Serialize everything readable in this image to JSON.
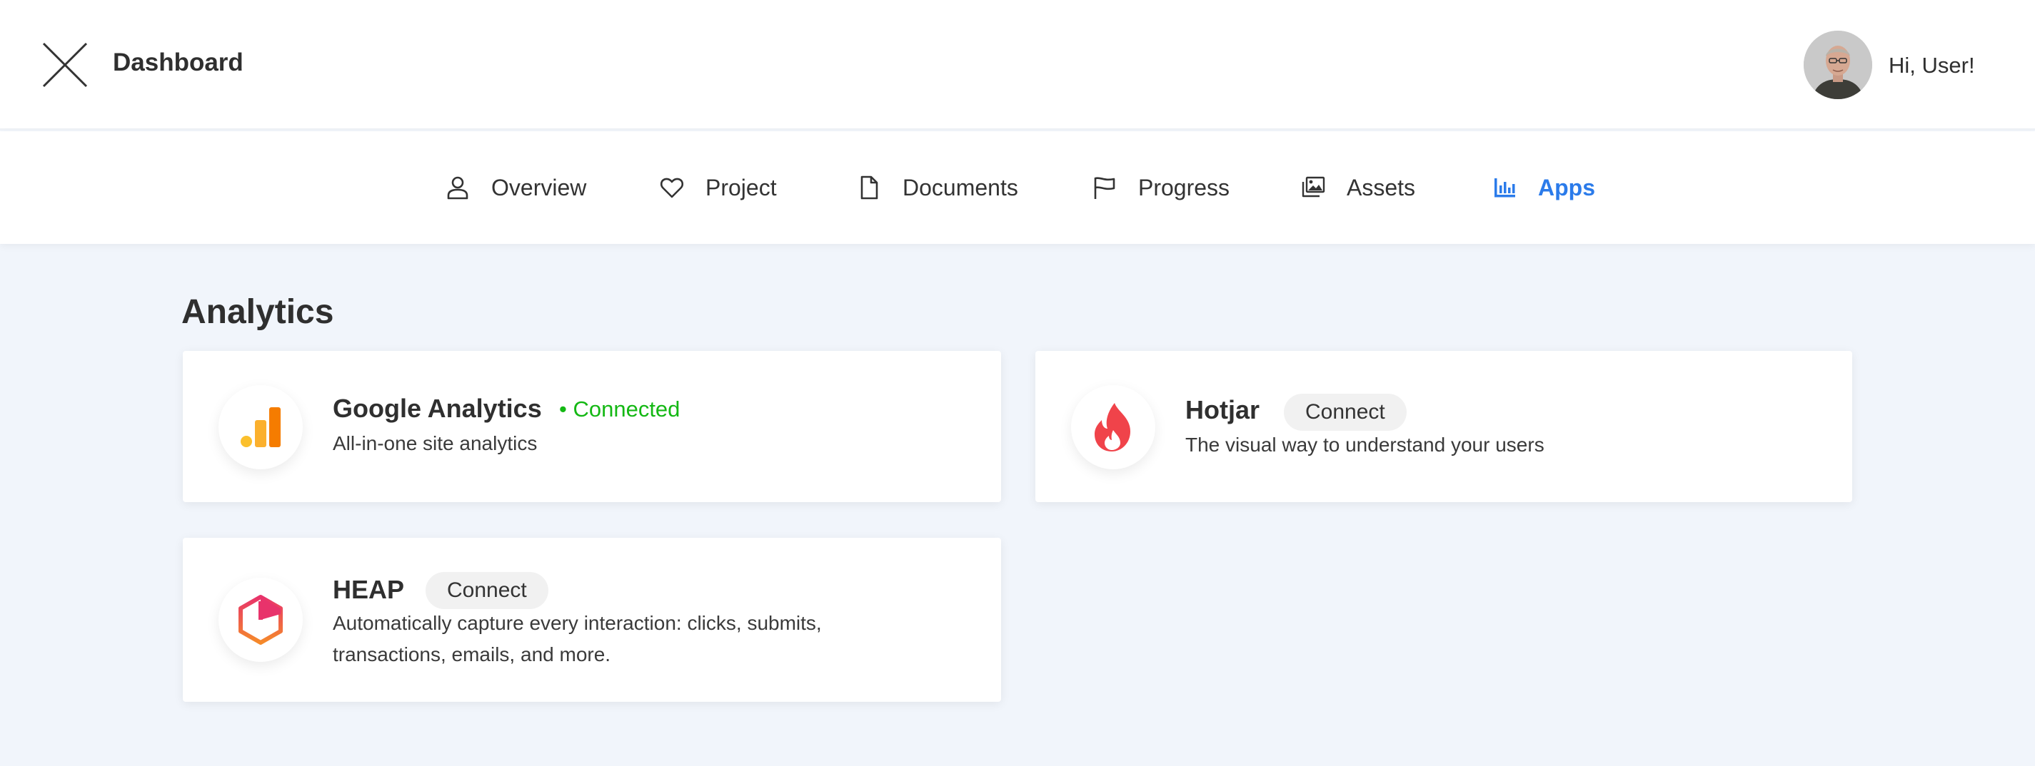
{
  "header": {
    "title": "Dashboard",
    "greeting": "Hi, User!"
  },
  "nav": {
    "tabs": [
      {
        "label": "Overview",
        "icon": "user-icon",
        "active": false
      },
      {
        "label": "Project",
        "icon": "heart-icon",
        "active": false
      },
      {
        "label": "Documents",
        "icon": "document-icon",
        "active": false
      },
      {
        "label": "Progress",
        "icon": "flag-icon",
        "active": false
      },
      {
        "label": "Assets",
        "icon": "images-icon",
        "active": false
      },
      {
        "label": "Apps",
        "icon": "bar-chart-icon",
        "active": true
      }
    ]
  },
  "section": {
    "title": "Analytics"
  },
  "apps": [
    {
      "name": "Google Analytics",
      "status": "• Connected",
      "description": "All-in-one site analytics",
      "icon": "google-analytics-icon"
    },
    {
      "name": "Hotjar",
      "action": "Connect",
      "description": "The visual way to understand your users",
      "icon": "hotjar-flame-icon"
    },
    {
      "name": "HEAP",
      "action": "Connect",
      "description": "Automatically capture every interaction: clicks, submits, transactions, emails, and more.",
      "icon": "heap-hexagon-icon"
    }
  ],
  "colors": {
    "accent": "#2b7bea",
    "connected": "#14b814",
    "background": "#f1f5fb",
    "ga_orange": "#f57c00",
    "ga_yellow": "#fbc02d",
    "hotjar": "#f0434a",
    "heap_pink": "#e8336b",
    "heap_orange": "#f58a2a"
  }
}
